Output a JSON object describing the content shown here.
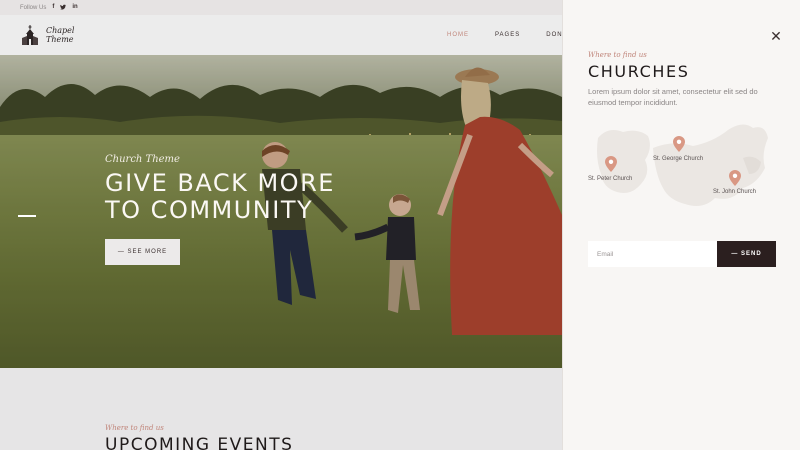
{
  "topbar": {
    "follow_label": "Follow Us",
    "social": [
      "f",
      "t",
      "in"
    ]
  },
  "header": {
    "logo_line1": "Chapel",
    "logo_line2": "Theme",
    "nav": [
      "HOME",
      "PAGES",
      "DONATE"
    ]
  },
  "hero": {
    "subtitle": "Church Theme",
    "title_line1": "GIVE BACK MORE",
    "title_line2": "TO COMMUNITY",
    "cta_label": "— SEE MORE"
  },
  "section": {
    "subtitle": "Where to find us",
    "title": "UPCOMING EVENTS"
  },
  "panel": {
    "subtitle": "Where to find us",
    "title": "CHURCHES",
    "description": "Lorem ipsum dolor sit amet, consectetur elit sed do eiusmod tempor incididunt.",
    "churches": [
      "St. Peter Church",
      "St. George Church",
      "St. John Church"
    ],
    "email_placeholder": "Email",
    "send_label": "— SEND"
  },
  "colors": {
    "accent": "#c0857a",
    "dark": "#2b1f1f",
    "panel_bg": "#f8f6f4"
  }
}
